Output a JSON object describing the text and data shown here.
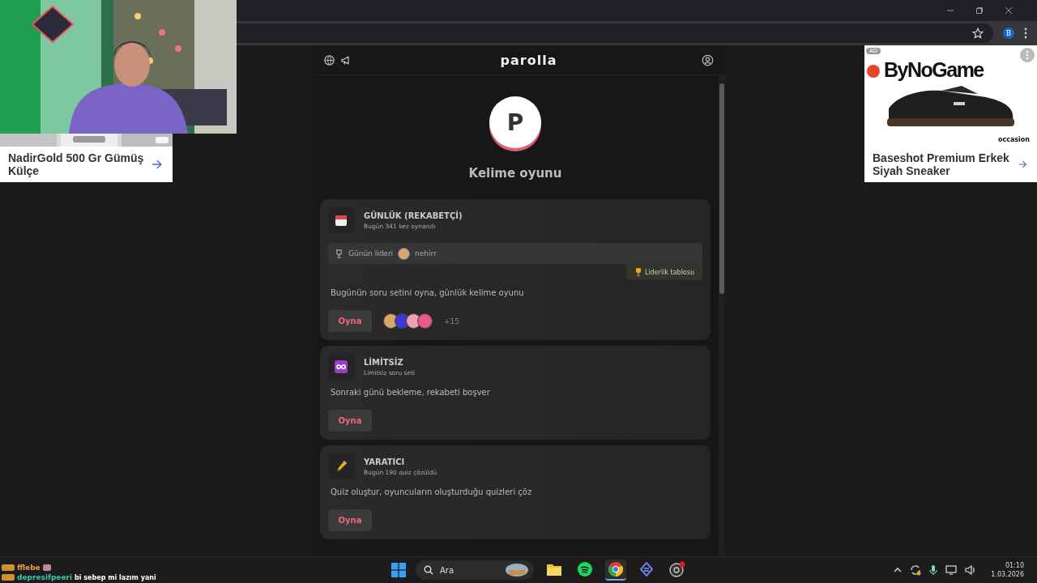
{
  "browser": {
    "account_initial": "B"
  },
  "ads": [
    {
      "kind": "left",
      "title": "NadirGold 500 Gr Gümüş Külçe"
    },
    {
      "kind": "right",
      "badge": "AD",
      "brand": "ByNoGame",
      "tag": "occasion",
      "title": "Baseshot Premium Erkek Siyah Sneaker"
    }
  ],
  "app": {
    "title": "parolla",
    "logo_letter": "P",
    "heading": "Kelime oyunu",
    "modes": [
      {
        "kind": "calendar",
        "title": "GÜNLÜK (REKABETÇİ)",
        "subtitle": "Bugün 341 kez oynandı",
        "leader": {
          "label": "Günün lideri",
          "name": "nehirr"
        },
        "leaderboard": "Liderlik tablosu",
        "description": "Bugünün soru setini oyna, günlük kelime oyunu",
        "play": "Oyna",
        "players_more": "+15"
      },
      {
        "kind": "infinity",
        "title": "LİMİTSİZ",
        "subtitle": "Limitsiz soru seti",
        "description": "Sonraki günü bekleme, rekabeti boşver",
        "play": "Oyna"
      },
      {
        "kind": "pencil",
        "title": "YARATICI",
        "subtitle": "Bugün 190 quiz çözüldü",
        "description": "Quiz oluştur, oyuncuların oluşturduğu quizleri çöz",
        "play": "Oyna"
      }
    ]
  },
  "chat": [
    {
      "kind": "emote",
      "user": "fflebe",
      "color": "#e8a33a"
    },
    {
      "kind": "text",
      "user": "depresifpeeri",
      "color": "#3fc6a8",
      "message": "bi sebep mi lazım yani"
    }
  ],
  "taskbar": {
    "search_placeholder": "Ara",
    "apps": [
      {
        "kind": "folder",
        "selected": false
      },
      {
        "kind": "spotify",
        "selected": false
      },
      {
        "kind": "chrome",
        "selected": true
      },
      {
        "kind": "diamond",
        "selected": false
      },
      {
        "kind": "obs",
        "selected": false
      }
    ],
    "time": "01:10",
    "date": "1.03.2026"
  }
}
